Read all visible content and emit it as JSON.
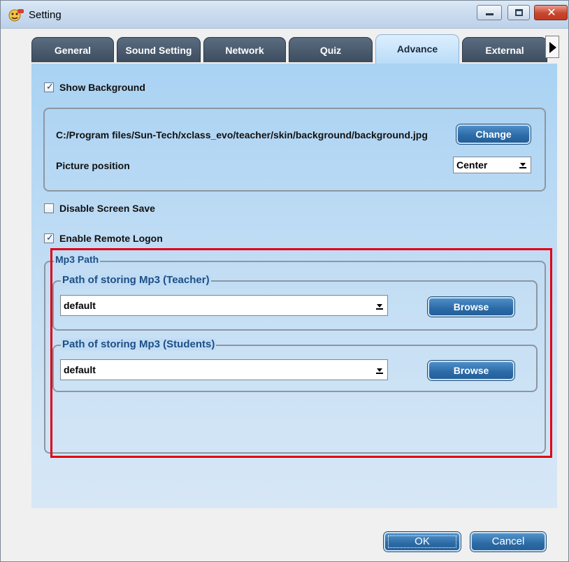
{
  "window": {
    "title": "Setting"
  },
  "tabs": [
    {
      "label": "General"
    },
    {
      "label": "Sound Setting"
    },
    {
      "label": "Network"
    },
    {
      "label": "Quiz"
    },
    {
      "label": "Advance"
    },
    {
      "label": "External"
    }
  ],
  "active_tab": "Advance",
  "advance": {
    "show_background": {
      "label": "Show Background",
      "checked": true
    },
    "background": {
      "path": "C:/Program files/Sun-Tech/xclass_evo/teacher/skin/background/background.jpg",
      "change_label": "Change",
      "position_label": "Picture position",
      "position_value": "Center"
    },
    "disable_screen_save": {
      "label": "Disable Screen Save",
      "checked": false
    },
    "enable_remote_logon": {
      "label": "Enable Remote Logon",
      "checked": true
    },
    "mp3": {
      "legend": "Mp3 Path",
      "teacher": {
        "legend": "Path of storing Mp3 (Teacher)",
        "value": "default",
        "browse_label": "Browse"
      },
      "students": {
        "legend": "Path of storing Mp3 (Students)",
        "value": "default",
        "browse_label": "Browse"
      }
    }
  },
  "footer": {
    "ok_label": "OK",
    "cancel_label": "Cancel"
  },
  "colors": {
    "highlight": "#e00010",
    "accent": "#2b6aa6"
  }
}
